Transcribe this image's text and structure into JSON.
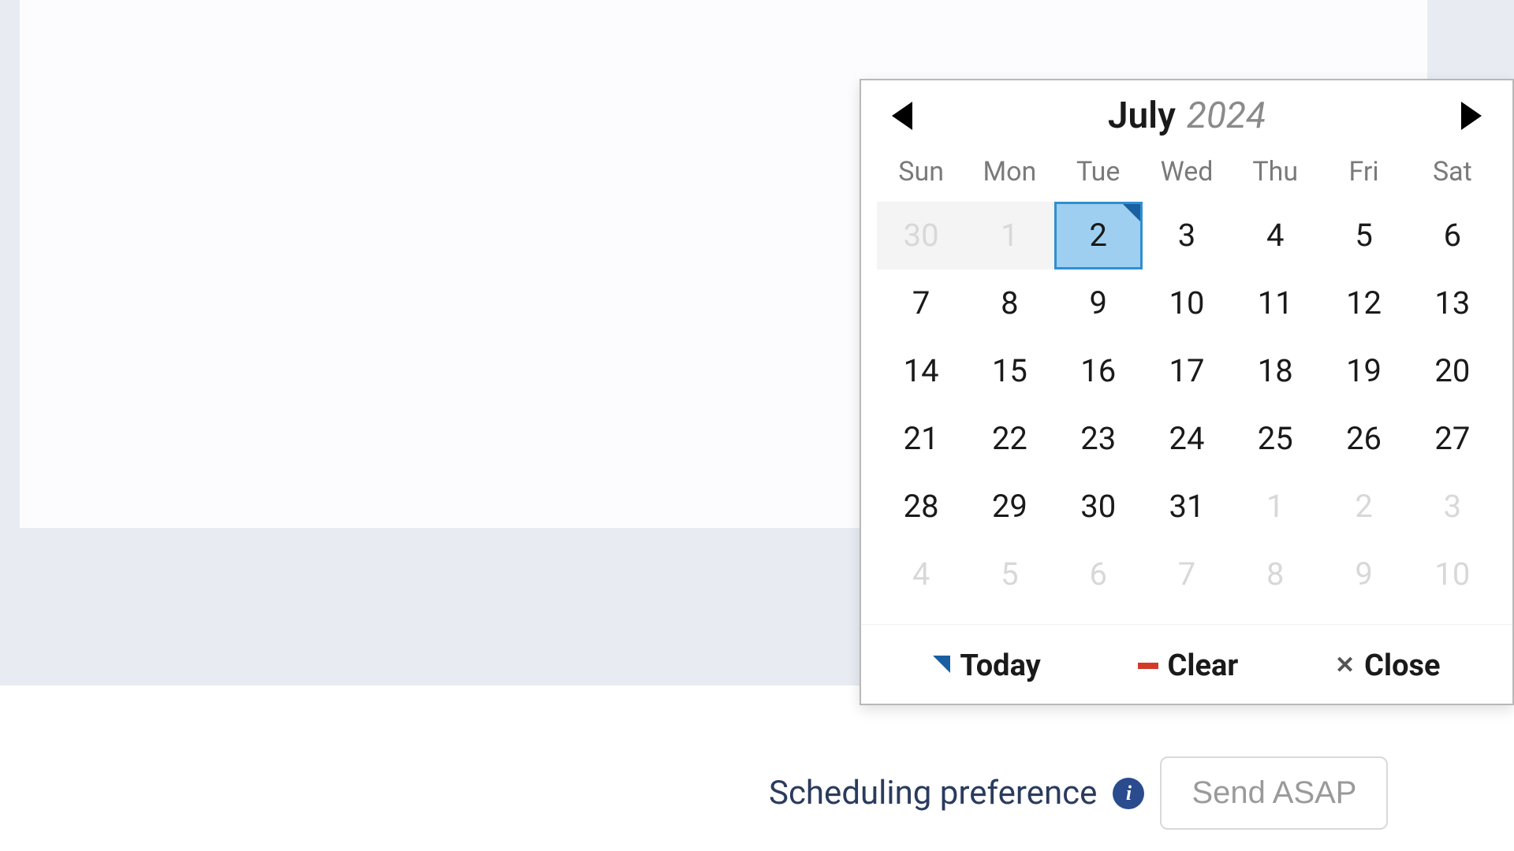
{
  "datepicker": {
    "month": "July",
    "year": "2024",
    "dow": [
      "Sun",
      "Mon",
      "Tue",
      "Wed",
      "Thu",
      "Fri",
      "Sat"
    ],
    "weeks": [
      [
        {
          "d": "30",
          "other": true,
          "disabled": true
        },
        {
          "d": "1",
          "other": true,
          "disabled": true
        },
        {
          "d": "2",
          "selected": true
        },
        {
          "d": "3"
        },
        {
          "d": "4"
        },
        {
          "d": "5"
        },
        {
          "d": "6"
        }
      ],
      [
        {
          "d": "7"
        },
        {
          "d": "8"
        },
        {
          "d": "9"
        },
        {
          "d": "10"
        },
        {
          "d": "11"
        },
        {
          "d": "12"
        },
        {
          "d": "13"
        }
      ],
      [
        {
          "d": "14"
        },
        {
          "d": "15"
        },
        {
          "d": "16"
        },
        {
          "d": "17"
        },
        {
          "d": "18"
        },
        {
          "d": "19"
        },
        {
          "d": "20"
        }
      ],
      [
        {
          "d": "21"
        },
        {
          "d": "22"
        },
        {
          "d": "23"
        },
        {
          "d": "24"
        },
        {
          "d": "25"
        },
        {
          "d": "26"
        },
        {
          "d": "27"
        }
      ],
      [
        {
          "d": "28"
        },
        {
          "d": "29"
        },
        {
          "d": "30"
        },
        {
          "d": "31"
        },
        {
          "d": "1",
          "other": true
        },
        {
          "d": "2",
          "other": true
        },
        {
          "d": "3",
          "other": true
        }
      ],
      [
        {
          "d": "4",
          "other": true
        },
        {
          "d": "5",
          "other": true
        },
        {
          "d": "6",
          "other": true
        },
        {
          "d": "7",
          "other": true
        },
        {
          "d": "8",
          "other": true
        },
        {
          "d": "9",
          "other": true
        },
        {
          "d": "10",
          "other": true
        }
      ]
    ],
    "actions": {
      "today": "Today",
      "clear": "Clear",
      "close": "Close"
    }
  },
  "scheduling": {
    "label": "Scheduling preference",
    "button": "Send ASAP"
  }
}
